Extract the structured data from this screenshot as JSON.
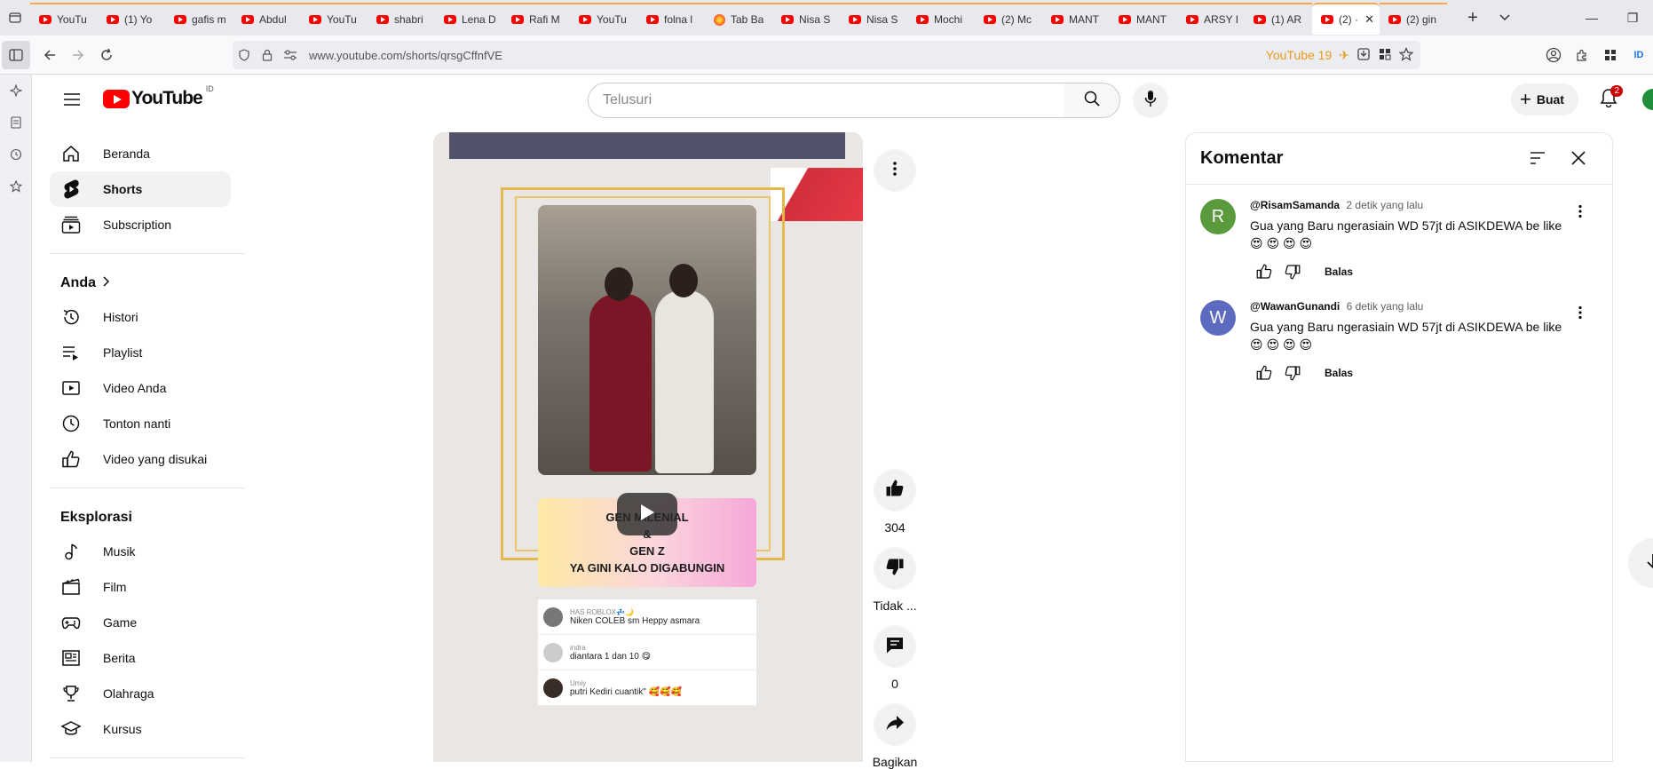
{
  "browser": {
    "tabs": [
      {
        "label": "YouTu",
        "favicon": "youtube"
      },
      {
        "label": "(1) Yo",
        "favicon": "youtube"
      },
      {
        "label": "gafis m",
        "favicon": "youtube"
      },
      {
        "label": "Abdul",
        "favicon": "youtube"
      },
      {
        "label": "YouTu",
        "favicon": "youtube"
      },
      {
        "label": "shabri",
        "favicon": "youtube"
      },
      {
        "label": "Lena D",
        "favicon": "youtube"
      },
      {
        "label": "Rafi M",
        "favicon": "youtube"
      },
      {
        "label": "YouTu",
        "favicon": "youtube"
      },
      {
        "label": "folna l",
        "favicon": "youtube"
      },
      {
        "label": "Tab Ba",
        "favicon": "firefox"
      },
      {
        "label": "Nisa S",
        "favicon": "youtube"
      },
      {
        "label": "Nisa S",
        "favicon": "youtube"
      },
      {
        "label": "Mochi",
        "favicon": "youtube"
      },
      {
        "label": "(2) Mc",
        "favicon": "youtube"
      },
      {
        "label": "MANT",
        "favicon": "youtube"
      },
      {
        "label": "MANT",
        "favicon": "youtube"
      },
      {
        "label": "ARSY I",
        "favicon": "youtube"
      },
      {
        "label": "(1) AR",
        "favicon": "youtube"
      },
      {
        "label": "(2) ·",
        "favicon": "youtube",
        "active": true
      },
      {
        "label": "(2) gin",
        "favicon": "youtube"
      }
    ],
    "url": "www.youtube.com/shorts/qrsgCffnfVE",
    "url_badge": "YouTube 19"
  },
  "header": {
    "logo_text": "YouTube",
    "country_code": "ID",
    "search_placeholder": "Telusuri",
    "create_label": "Buat",
    "notification_count": "2"
  },
  "nav": {
    "main": [
      {
        "label": "Beranda",
        "icon": "home-icon"
      },
      {
        "label": "Shorts",
        "icon": "shorts-icon",
        "active": true
      },
      {
        "label": "Subscription",
        "icon": "subscriptions-icon"
      }
    ],
    "you_title": "Anda",
    "you": [
      {
        "label": "Histori",
        "icon": "history-icon"
      },
      {
        "label": "Playlist",
        "icon": "playlist-icon"
      },
      {
        "label": "Video Anda",
        "icon": "your-videos-icon"
      },
      {
        "label": "Tonton nanti",
        "icon": "watch-later-icon"
      },
      {
        "label": "Video yang disukai",
        "icon": "liked-icon"
      }
    ],
    "explore_title": "Eksplorasi",
    "explore": [
      {
        "label": "Musik",
        "icon": "music-icon"
      },
      {
        "label": "Film",
        "icon": "film-icon"
      },
      {
        "label": "Game",
        "icon": "gaming-icon"
      },
      {
        "label": "Berita",
        "icon": "news-icon"
      },
      {
        "label": "Olahraga",
        "icon": "sports-icon"
      },
      {
        "label": "Kursus",
        "icon": "courses-icon"
      }
    ]
  },
  "video": {
    "caption_line1": "GEN MILENIAL",
    "caption_line2": "&",
    "caption_line3": "GEN Z",
    "caption_line4": "YA GINI KALO DIGABUNGIN",
    "overlay_comments": [
      {
        "name": "HAS ROBLOX💤🌙",
        "text": "Niken COLEB sm Heppy asmara"
      },
      {
        "name": "indra",
        "text": "diantara 1 dan 10 😋"
      },
      {
        "name": "Umiy",
        "text": "putri Kediri cuantik\" 🥰🥰🥰"
      }
    ]
  },
  "actions": {
    "like_count": "304",
    "dislike_label": "Tidak ...",
    "comment_count": "0",
    "share_label": "Bagikan"
  },
  "comments": {
    "title": "Komentar",
    "items": [
      {
        "avatar_letter": "R",
        "avatar_color": "#5b9a3c",
        "author": "@RisamSamanda",
        "time": "2 detik yang lalu",
        "text": "Gua yang Baru ngerasiain WD 57jt di ASIKDEWA be like",
        "emoji": "😍 😍 😍 😍",
        "reply": "Balas"
      },
      {
        "avatar_letter": "W",
        "avatar_color": "#5c6bc0",
        "author": "@WawanGunandi",
        "time": "6 detik yang lalu",
        "text": "Gua yang Baru ngerasiain WD 57jt di ASIKDEWA be like",
        "emoji": "😍 😍 😍 😍",
        "reply": "Balas"
      }
    ]
  }
}
